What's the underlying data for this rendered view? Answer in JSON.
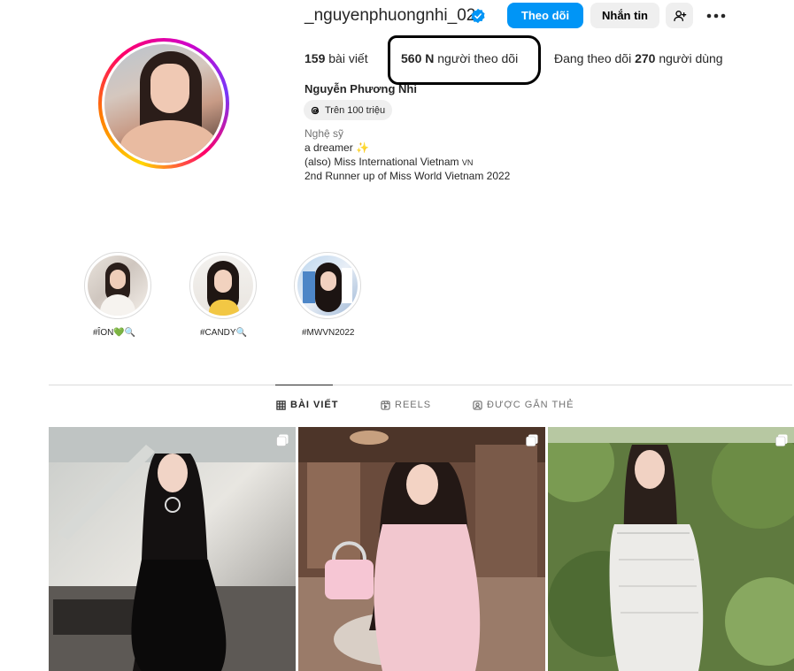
{
  "profile": {
    "username": "_nguyenphuongnhi_02",
    "verified_icon": "verified-badge-icon",
    "follow_label": "Theo dõi",
    "message_label": "Nhắn tin",
    "stats": {
      "posts_count": "159",
      "posts_label": "bài viết",
      "followers_count": "560 N",
      "followers_label": "người theo dõi",
      "following_prefix": "Đang theo dõi",
      "following_count": "270",
      "following_suffix": "người dùng"
    },
    "full_name": "Nguyễn Phương Nhi",
    "threads_label": "Trên 100 triệu",
    "category": "Nghệ sỹ",
    "bio": {
      "line1": "a dreamer",
      "line1_emoji": "✨",
      "line2": "(also) Miss International Vietnam",
      "line2_flag": "VN",
      "line3": "2nd Runner up of Miss World Vietnam 2022"
    }
  },
  "highlights": [
    {
      "label": "#ÎON",
      "emoji": "💚🔍"
    },
    {
      "label": "#CANDY",
      "emoji": "🔍"
    },
    {
      "label": "#MWVN2022",
      "emoji": ""
    }
  ],
  "tabs": [
    {
      "label": "BÀI VIẾT",
      "icon": "grid-icon",
      "active": true
    },
    {
      "label": "REELS",
      "icon": "reels-icon",
      "active": false
    },
    {
      "label": "ĐƯỢC GẮN THẺ",
      "icon": "tagged-icon",
      "active": false
    }
  ],
  "colors": {
    "primary_button": "#0095f6",
    "secondary_button": "#efefef",
    "text": "#262626",
    "muted": "#737373"
  }
}
